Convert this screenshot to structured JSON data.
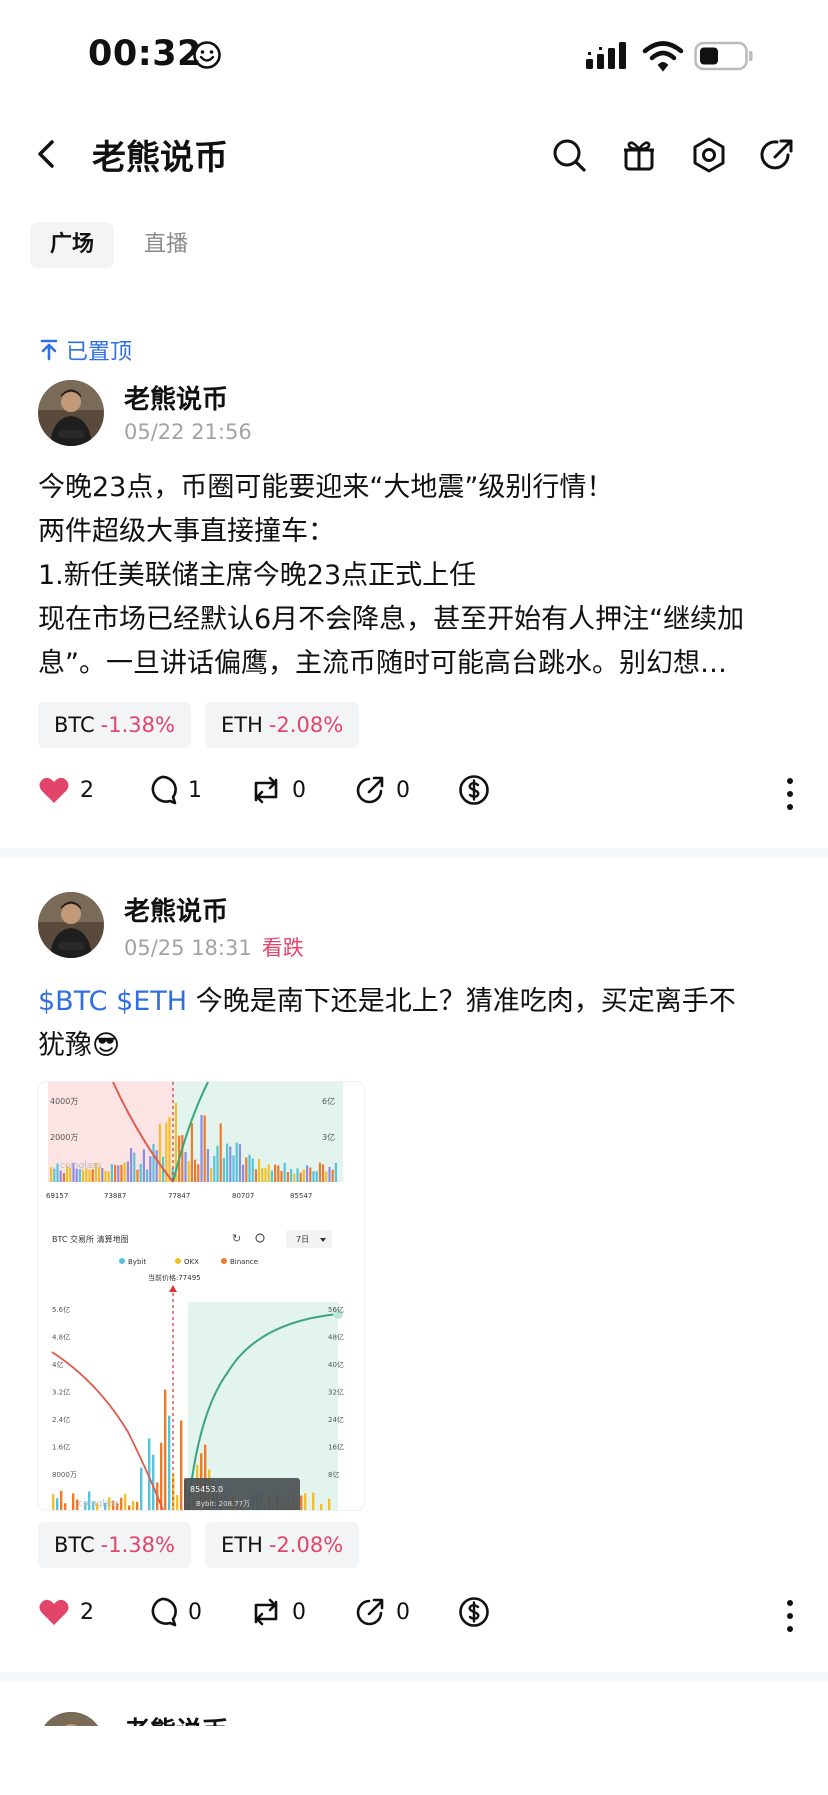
{
  "status_bar": {
    "time": "00:32"
  },
  "header": {
    "title": "老熊说币"
  },
  "tabs": [
    {
      "label": "广场",
      "active": true
    },
    {
      "label": "直播",
      "active": false
    }
  ],
  "posts": [
    {
      "pinned_label": "已置顶",
      "author": "老熊说币",
      "timestamp": "05/22 21:56",
      "lines": [
        "今晚23点，币圈可能要迎来“大地震”级别行情！",
        "两件超级大事直接撞车：",
        "1.新任美联储主席今晚23点正式上任",
        "现在市场已经默认6月不会降息，甚至开始有人押注“继续加",
        "息”。一旦讲话偏鹰，主流币随时可能高台跳水。别幻想…"
      ],
      "chips": [
        {
          "symbol": "BTC",
          "change": "-1.38%"
        },
        {
          "symbol": "ETH",
          "change": "-2.08%"
        }
      ],
      "likes": "2",
      "comments": "1",
      "reposts": "0",
      "shares": "0"
    },
    {
      "author": "老熊说币",
      "timestamp": "05/25 18:31",
      "sentiment": "看跌",
      "tag1": "$BTC",
      "tag2": "$ETH",
      "text_line1": " 今晚是南下还是北上？猜准吃肉，买定离手不",
      "text_line2": "犹豫😎",
      "chips": [
        {
          "symbol": "BTC",
          "change": "-1.38%"
        },
        {
          "symbol": "ETH",
          "change": "-2.08%"
        }
      ],
      "likes": "2",
      "comments": "0",
      "reposts": "0",
      "shares": "0"
    },
    {
      "author": "老熊说币"
    }
  ],
  "chart_image": {
    "top_y_left": [
      "4000万",
      "2000万"
    ],
    "top_y_right": [
      "6亿",
      "3亿"
    ],
    "top_x": [
      "69157",
      "73887",
      "77847",
      "80707",
      "85547"
    ],
    "title": "BTC 交易所  清算地图",
    "period": "7日",
    "legend": [
      "Bybit",
      "OKX",
      "Binance"
    ],
    "current_price": "当前价格:77495",
    "left_y": [
      "5.6亿",
      "4.8亿",
      "4亿",
      "3.2亿",
      "2.4亿",
      "1.6亿",
      "8000万"
    ],
    "right_y": [
      "56亿",
      "48亿",
      "40亿",
      "32亿",
      "24亿",
      "16亿",
      "8亿"
    ],
    "tooltip_price": "85453.0",
    "tooltip_value": "Bybit: 208.77万",
    "watermark": "coinglass"
  },
  "colors": {
    "accent_blue": "#2f6fe0",
    "down_red": "#e2456a",
    "like_red": "#e2456a"
  }
}
